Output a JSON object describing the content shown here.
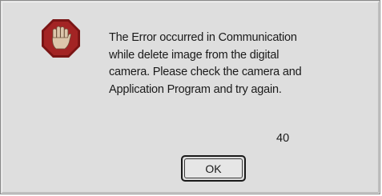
{
  "dialog": {
    "icon": "stop-hand-icon",
    "message": "The Error occurred in Communication\nwhile delete image from the digital\ncamera. Please check the camera and\nApplication Program and try again.",
    "error_code": "40",
    "ok_label": "OK"
  },
  "colors": {
    "background": "#dedede",
    "icon_octagon": "#9b1c1c",
    "icon_hand": "#d9c3a8"
  }
}
